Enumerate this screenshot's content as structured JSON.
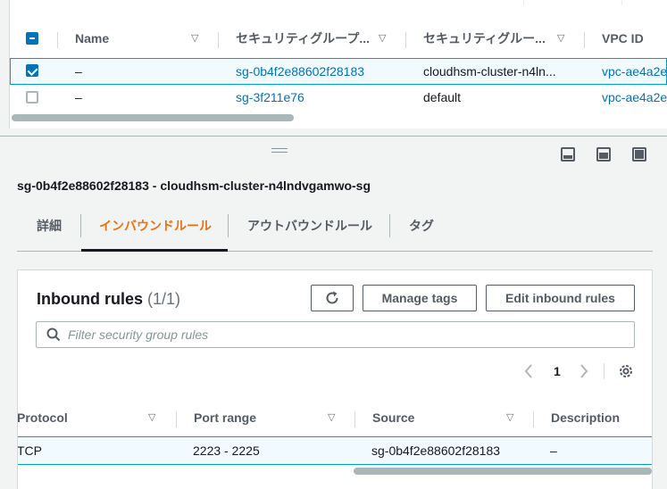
{
  "security_groups_table": {
    "columns": [
      {
        "label": "Name"
      },
      {
        "label": "セキュリティグループ..."
      },
      {
        "label": "セキュリティグルー..."
      },
      {
        "label": "VPC ID"
      }
    ],
    "rows": [
      {
        "selected": true,
        "name": "–",
        "group_id": "sg-0b4f2e88602f28183",
        "group_name": "cloudhsm-cluster-n4ln...",
        "vpc_id": "vpc-ae4a2e"
      },
      {
        "selected": false,
        "name": "–",
        "group_id": "sg-3f211e76",
        "group_name": "default",
        "vpc_id": "vpc-ae4a2e"
      }
    ]
  },
  "detail": {
    "title": "sg-0b4f2e88602f28183 - cloudhsm-cluster-n4lndvgamwo-sg",
    "tabs": [
      {
        "label": "詳細",
        "active": false
      },
      {
        "label": "インバウンドルール",
        "active": true
      },
      {
        "label": "アウトバウンドルール",
        "active": false
      },
      {
        "label": "タグ",
        "active": false
      }
    ]
  },
  "inbound_rules": {
    "title": "Inbound rules",
    "count": "(1/1)",
    "buttons": {
      "refresh_icon": "refresh-icon",
      "manage_tags": "Manage tags",
      "edit_inbound_rules": "Edit inbound rules"
    },
    "search": {
      "placeholder": "Filter security group rules",
      "value": ""
    },
    "pagination": {
      "current_page": "1"
    },
    "columns": [
      {
        "label": "Protocol"
      },
      {
        "label": "Port range"
      },
      {
        "label": "Source"
      },
      {
        "label": "Description"
      }
    ],
    "rows": [
      {
        "protocol": "TCP",
        "port_range": "2223 - 2225",
        "source": "sg-0b4f2e88602f28183",
        "description": "–"
      }
    ]
  },
  "colors": {
    "accent_orange": "#ec7211",
    "link_blue": "#0073bb",
    "selected_row_bg": "#f1faff",
    "selected_row_border": "#00a1c9"
  }
}
